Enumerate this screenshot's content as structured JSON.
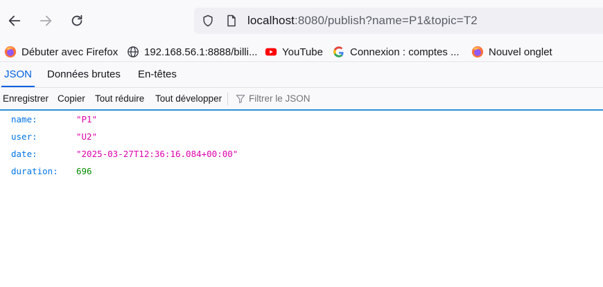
{
  "toolbar": {
    "back_icon": "arrow-left-icon",
    "forward_icon": "arrow-right-icon",
    "reload_icon": "reload-icon",
    "url_host": "localhost",
    "url_rest": ":8080/publish?name=P1&topic=T2"
  },
  "bookmarks": [
    {
      "label": "Débuter avec Firefox",
      "icon": "firefox-icon"
    },
    {
      "label": "192.168.56.1:8888/billi...",
      "icon": "globe-icon"
    },
    {
      "label": "YouTube",
      "icon": "youtube-icon"
    },
    {
      "label": "Connexion : comptes ...",
      "icon": "google-icon"
    },
    {
      "label": "Nouvel onglet",
      "icon": "firefox-icon"
    }
  ],
  "viewer": {
    "tabs": [
      "JSON",
      "Données brutes",
      "En-têtes"
    ],
    "active_tab": "JSON",
    "actions": [
      "Enregistrer",
      "Copier",
      "Tout réduire",
      "Tout développer"
    ],
    "filter_placeholder": "Filtrer le JSON"
  },
  "json": [
    {
      "key": "name:",
      "value": "\"P1\"",
      "type": "string"
    },
    {
      "key": "user:",
      "value": "\"U2\"",
      "type": "string"
    },
    {
      "key": "date:",
      "value": "\"2025-03-27T12:36:16.084+00:00\"",
      "type": "string"
    },
    {
      "key": "duration:",
      "value": "696",
      "type": "number"
    }
  ],
  "colors": {
    "accent": "#0061e0",
    "json_key": "#0074e8",
    "json_string": "#dd00a9",
    "json_number": "#058b00"
  }
}
